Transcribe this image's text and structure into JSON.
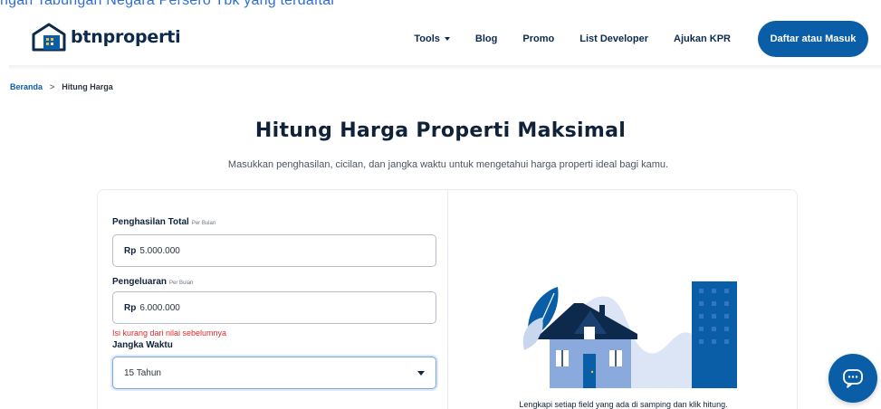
{
  "top_fragment": "ngan Tabungan Negara Persero Tbk yang terdaftar",
  "brand": {
    "name": "btnproperti",
    "colors": {
      "primary": "#0a5ea7",
      "navy": "#0d2a4d"
    }
  },
  "nav": {
    "items": [
      {
        "label": "Tools",
        "has_dropdown": true
      },
      {
        "label": "Blog"
      },
      {
        "label": "Promo"
      },
      {
        "label": "List Developer"
      },
      {
        "label": "Ajukan KPR"
      }
    ],
    "cta": "Daftar atau Masuk"
  },
  "breadcrumb": {
    "home": "Beranda",
    "separator": ">",
    "current": "Hitung Harga"
  },
  "page": {
    "title": "Hitung Harga Properti Maksimal",
    "subtitle": "Masukkan penghasilan, cicilan, dan jangka waktu untuk mengetahui harga properti ideal bagi kamu."
  },
  "form": {
    "income": {
      "label": "Penghasilan Total",
      "suffix": "Per Bulan",
      "currency": "Rp",
      "value": "5.000.000"
    },
    "expense": {
      "label": "Pengeluaran",
      "suffix": "Per Bulan",
      "currency": "Rp",
      "value": "6.000.000",
      "error": "Isi kurang dari nilai sebelumnya"
    },
    "term": {
      "label": "Jangka Waktu",
      "selected": "15 Tahun"
    }
  },
  "illustration": {
    "caption": "Lengkapi setiap field yang ada di samping dan klik hitung."
  },
  "icons": {
    "chat": "chat-bubble-icon",
    "logo": "house-logo-icon"
  }
}
